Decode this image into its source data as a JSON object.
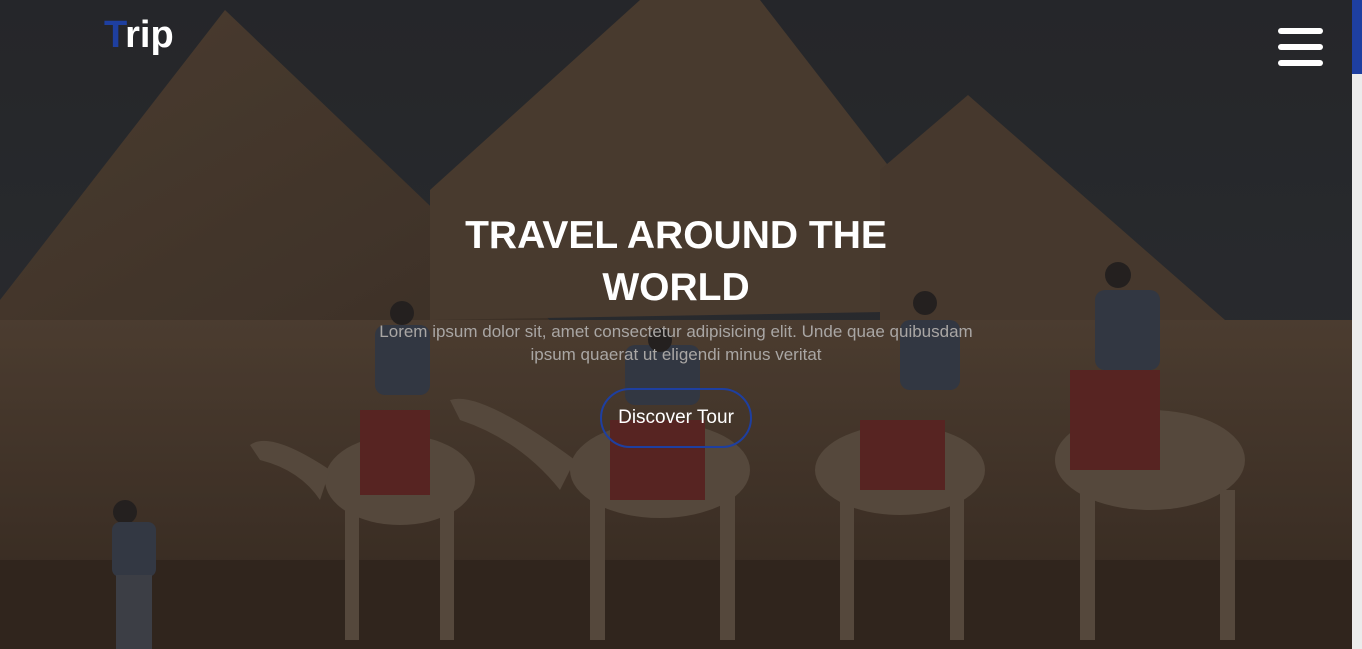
{
  "brand": {
    "logo_first_letter": "T",
    "logo_rest": "rip",
    "accent_color": "#1e3fa0"
  },
  "nav": {
    "menu_icon": "hamburger-menu-icon"
  },
  "hero": {
    "title_line1": "TRAVEL AROUND THE",
    "title_line2": "WORLD",
    "subtitle": "Lorem ipsum dolor sit, amet consectetur adipisicing elit. Unde quae quibusdam ipsum quaerat ut eligendi minus veritat",
    "cta_label": "Discover Tour",
    "background_image": "pyramids-camels-photo"
  }
}
